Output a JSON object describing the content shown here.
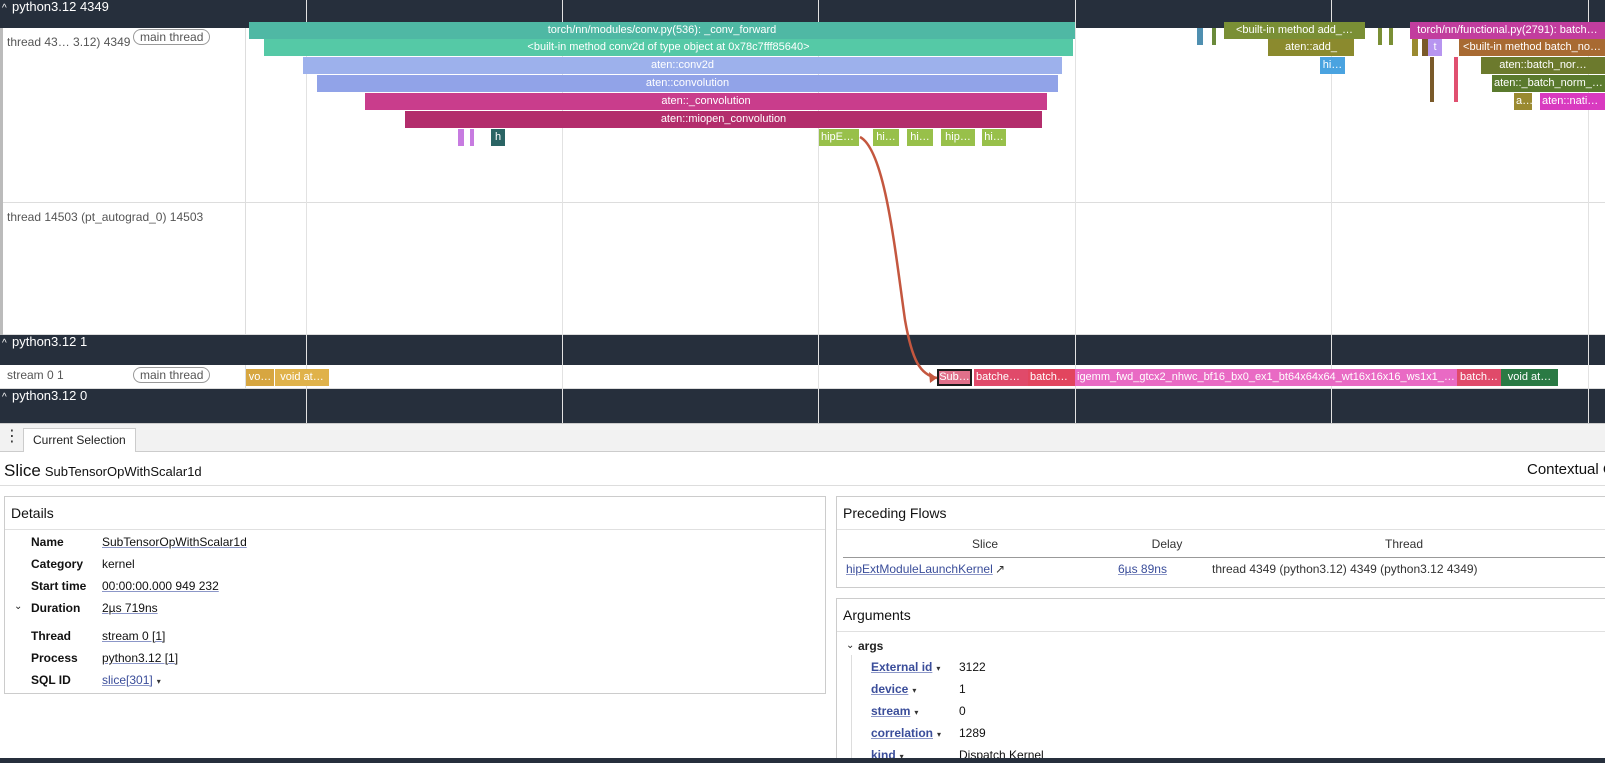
{
  "processes": {
    "p1": {
      "title": "python3.12 4349"
    },
    "p2": {
      "title": "python3.12 1"
    },
    "p3": {
      "title": "python3.12 0"
    }
  },
  "tracks": {
    "main": {
      "name": "thread 43…   3.12) 4349",
      "chip": "main thread"
    },
    "autograd": {
      "name": "thread 14503 (pt_autograd_0) 14503"
    },
    "stream": {
      "name": "stream 0 1",
      "chip": "main thread"
    }
  },
  "slices": {
    "conv_forward": "torch/nn/modules/conv.py(536): _conv_forward",
    "conv2d_builtin": "<built-in method conv2d of type object at 0x78c7fff85640>",
    "aten_conv2d": "aten::conv2d",
    "aten_convolution": "aten::convolution",
    "aten__convolution": "aten::_convolution",
    "miopen": "aten::miopen_convolution",
    "h": "h",
    "hipext": "hipEx…",
    "hi1": "hi…",
    "hi2": "hi…",
    "hip3": "hip…",
    "hi4": "hi…",
    "add_builtin": "<built-in method add_…",
    "aten_add": "aten::add_",
    "hi_add": "hi…",
    "functional": "torch/nn/functional.py(2791): batch…",
    "t": "t",
    "bn_builtin": "<built-in method batch_no…",
    "aten_bn": "aten::batch_nor…",
    "aten__bn": "aten::_batch_norm_in…",
    "a_small": "a…",
    "aten_native": "aten::nativ…",
    "vo": "vo…",
    "void_at1": "void at…",
    "sub": "Sub…",
    "batched1": "batched…",
    "batche2": "batche…",
    "igemm": "igemm_fwd_gtcx2_nhwc_bf16_bx0_ex1_bt64x64x64_wt16x16x16_ws1x1_w…",
    "batch3": "batch…",
    "void_at2": "void at…"
  },
  "panel": {
    "tab": "Current Selection",
    "kind": "Slice",
    "slice_name": "SubTensorOpWithScalar1d",
    "contextual": "Contextual C"
  },
  "details": {
    "title": "Details",
    "rows": {
      "name": {
        "k": "Name",
        "v": "SubTensorOpWithScalar1d"
      },
      "category": {
        "k": "Category",
        "v": "kernel"
      },
      "start": {
        "k": "Start time",
        "v": "00:00:00.000 949 232"
      },
      "duration": {
        "k": "Duration",
        "v": "2µs 719ns"
      },
      "thread": {
        "k": "Thread",
        "v": "stream 0  [1]"
      },
      "process": {
        "k": "Process",
        "v": "python3.12 [1]"
      },
      "sqlid": {
        "k": "SQL ID",
        "v": "slice[301]"
      }
    }
  },
  "flows": {
    "title": "Preceding Flows",
    "headers": {
      "slice": "Slice",
      "delay": "Delay",
      "thread": "Thread"
    },
    "row": {
      "slice": "hipExtModuleLaunchKernel",
      "delay": "6µs 89ns",
      "thread": "thread 4349 (python3.12) 4349 (python3.12 4349)"
    }
  },
  "arguments": {
    "title": "Arguments",
    "group": "args",
    "items": {
      "external_id": {
        "k": "External id",
        "v": "3122"
      },
      "device": {
        "k": "device",
        "v": "1"
      },
      "stream": {
        "k": "stream",
        "v": "0"
      },
      "correlation": {
        "k": "correlation",
        "v": "1289"
      },
      "kind": {
        "k": "kind",
        "v": "Dispatch Kernel"
      }
    }
  },
  "icons": {
    "chevron_up": "^",
    "chevron_down": "⌄",
    "kebab": "⋮",
    "external_link": "↗",
    "dropdown": "▾"
  },
  "colors": {
    "header_bg": "#262f3c",
    "link": "#3a4d9a",
    "flow_arrow": "#c4573f",
    "selected_outline": "#1b1b1b"
  }
}
